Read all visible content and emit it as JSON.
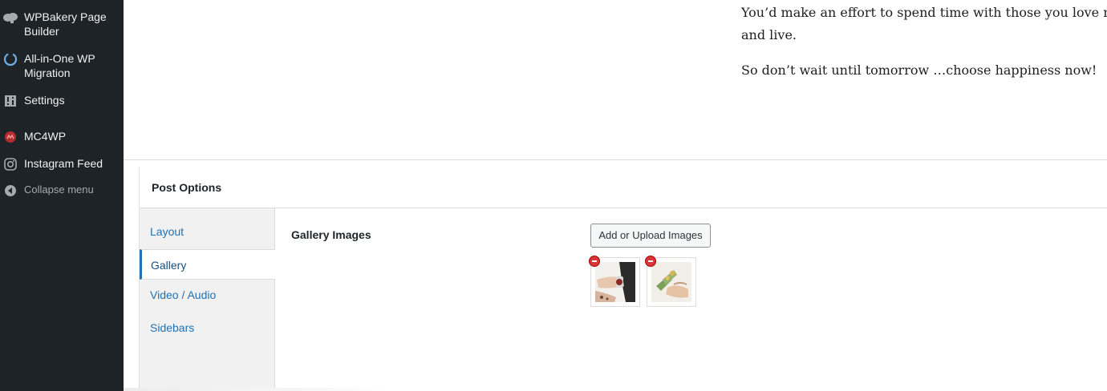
{
  "sidebar": {
    "items": [
      {
        "label": "WPBakery Page Builder",
        "icon": "wpbakery-cloud-icon"
      },
      {
        "label": "All-in-One WP Migration",
        "icon": "migration-icon"
      },
      {
        "label": "Settings",
        "icon": "settings-icon"
      },
      {
        "label": "MC4WP",
        "icon": "mc4wp-icon"
      },
      {
        "label": "Instagram Feed",
        "icon": "instagram-icon"
      }
    ],
    "collapse_label": "Collapse menu"
  },
  "content": {
    "line1": "You’d make an effort to spend time with those you love most",
    "line2": "and live.",
    "line3": "So don’t wait until tomorrow …choose happiness now!"
  },
  "post_options": {
    "title": "Post Options",
    "tabs": [
      {
        "label": "Layout"
      },
      {
        "label": "Gallery",
        "active": true
      },
      {
        "label": "Video / Audio"
      },
      {
        "label": "Sidebars"
      }
    ],
    "gallery": {
      "field_label": "Gallery Images",
      "upload_button": "Add or Upload Images",
      "images": [
        {
          "name": "watch-wrist-photo"
        },
        {
          "name": "flower-bouquet-photo"
        }
      ]
    }
  },
  "colors": {
    "sidebar_bg": "#1d2327",
    "link": "#2271b1",
    "remove_red": "#d63638"
  }
}
